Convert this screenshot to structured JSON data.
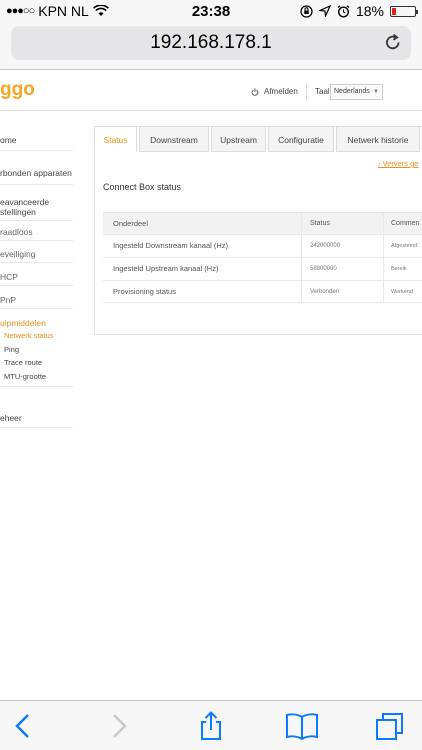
{
  "status_bar": {
    "carrier": "KPN NL",
    "time": "23:38",
    "battery": "18%",
    "battery_level": 0.18
  },
  "browser": {
    "url": "192.168.178.1"
  },
  "header": {
    "logo": "ggo",
    "logout_label": "Afmelden",
    "language_label": "Taal",
    "language_value": "Nederlands"
  },
  "sidebar": {
    "items": [
      {
        "label": "ome"
      },
      {
        "label": "rbonden apparaten"
      },
      {
        "label": "eavanceerde"
      },
      {
        "label": "stellingen"
      },
      {
        "label": "raadloos"
      },
      {
        "label": "eveiliging"
      },
      {
        "label": "HCP"
      },
      {
        "label": "PnP"
      },
      {
        "label": "ulpmiddelen"
      },
      {
        "label": "Netwerk status"
      },
      {
        "label": "Ping"
      },
      {
        "label": "Trace route"
      },
      {
        "label": "MTU-grootte"
      },
      {
        "label": "eheer"
      }
    ]
  },
  "tabs": [
    {
      "label": "Status"
    },
    {
      "label": "Downstream"
    },
    {
      "label": "Upstream"
    },
    {
      "label": "Configuratie"
    },
    {
      "label": "Netwerk historie"
    }
  ],
  "main": {
    "refresh_link": "Ververs ge",
    "title": "Connect Box status",
    "table": {
      "headers": [
        "Onderdeel",
        "Status",
        "Commen"
      ],
      "rows": [
        [
          "Ingesteld Downstream kanaal (Hz)",
          "242000000",
          "Afgestemd"
        ],
        [
          "Ingesteld Upstream kanaal (Hz)",
          "58800000",
          "Bereik"
        ],
        [
          "Provisioning status",
          "Verbonden",
          "Werkend"
        ]
      ]
    }
  },
  "colors": {
    "accent": "#e8911a",
    "ios_blue": "#0a7aff"
  }
}
